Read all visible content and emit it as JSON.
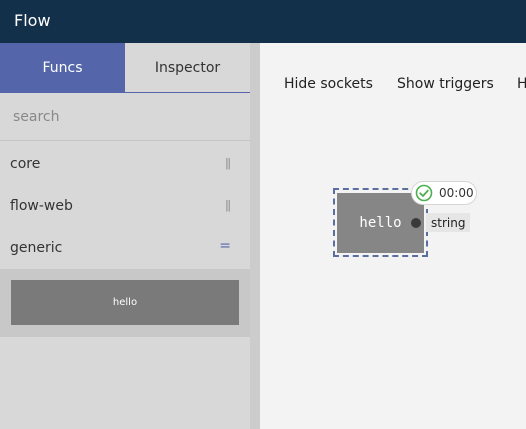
{
  "app": {
    "title": "Flow"
  },
  "sidebar": {
    "tabs": [
      {
        "label": "Funcs",
        "active": true
      },
      {
        "label": "Inspector",
        "active": false
      }
    ],
    "search": {
      "placeholder": "search",
      "value": ""
    },
    "categories": [
      {
        "label": "core",
        "expanded": false
      },
      {
        "label": "flow-web",
        "expanded": false
      },
      {
        "label": "generic",
        "expanded": true
      }
    ],
    "functions": [
      {
        "label": "hello"
      }
    ]
  },
  "toolbar": {
    "hide_sockets_label": "Hide sockets",
    "show_triggers_label": "Show triggers",
    "clipped_label": "H"
  },
  "canvas": {
    "node": {
      "label": "hello",
      "output_socket_type": "string",
      "timer": "00:00",
      "status": "success"
    }
  },
  "colors": {
    "topbar": "#12304a",
    "accent": "#5466a9",
    "node": "#868686",
    "success": "#4caf50"
  },
  "icons": {
    "drag_handle": "drag-handle-icon",
    "status": "check-circle-icon"
  }
}
